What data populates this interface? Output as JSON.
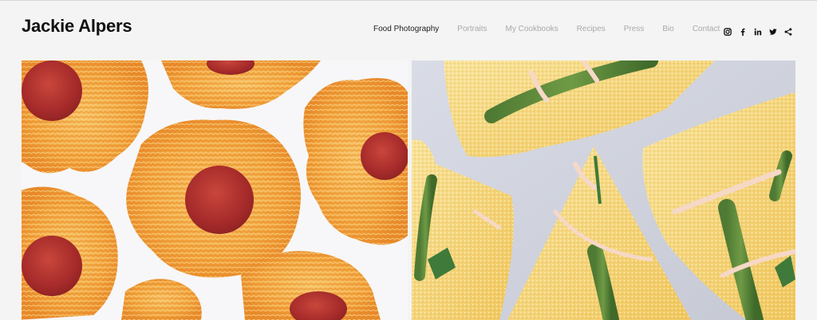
{
  "site": {
    "title": "Jackie Alpers"
  },
  "nav": {
    "items": [
      {
        "label": "Food Photography",
        "active": true
      },
      {
        "label": "Portraits",
        "active": false
      },
      {
        "label": "My Cookbooks",
        "active": false
      },
      {
        "label": "Recipes",
        "active": false
      },
      {
        "label": "Press",
        "active": false
      },
      {
        "label": "Bio",
        "active": false
      },
      {
        "label": "Contact",
        "active": false
      }
    ]
  },
  "social": {
    "icons": [
      "instagram-icon",
      "facebook-icon",
      "linkedin-icon",
      "twitter-icon",
      "share-icon"
    ]
  },
  "colors": {
    "background": "#f4f4f4",
    "nav_inactive": "#a9a9a9",
    "nav_active": "#222222",
    "cheese": "#f2a43a",
    "pepperoni": "#a8292b"
  }
}
